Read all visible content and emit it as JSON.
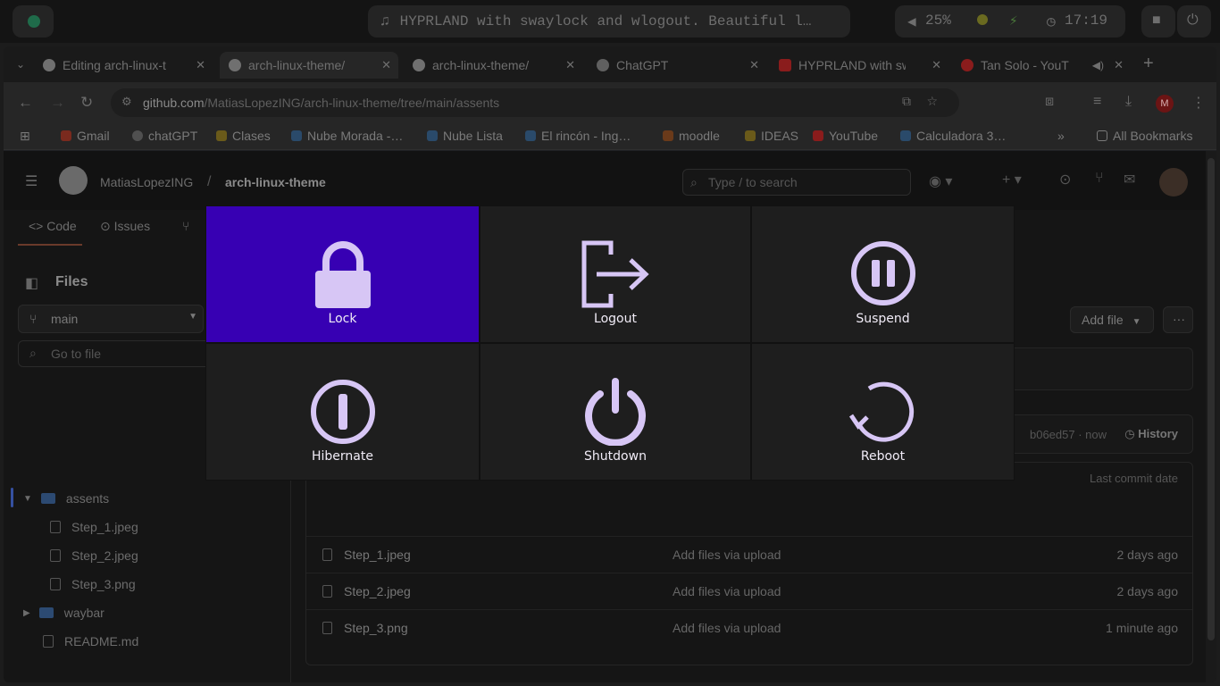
{
  "topbar": {
    "media_title": "HYPRLAND with swaylock and wlogout. Beautiful l…",
    "volume": "25%",
    "clock": "17:19"
  },
  "browser": {
    "tabs": [
      {
        "label": "Editing arch-linux-t",
        "favicon_color": "#707070"
      },
      {
        "label": "arch-linux-theme/",
        "favicon_color": "#707070"
      },
      {
        "label": "arch-linux-theme/",
        "favicon_color": "#707070"
      },
      {
        "label": "ChatGPT",
        "favicon_color": "#606060"
      },
      {
        "label": "HYPRLAND with sw",
        "favicon_color": "#8a1c1c"
      },
      {
        "label": "Tan Solo - YouT",
        "favicon_color": "#8a1c1c"
      }
    ],
    "url_host": "github.com",
    "url_path": "/MatiasLopezING/arch-linux-theme/tree/main/assents",
    "profile_initial": "M",
    "bookmarks": [
      {
        "label": "Gmail",
        "color": "#7a2a1e"
      },
      {
        "label": "chatGPT",
        "color": "#505050"
      },
      {
        "label": "Clases",
        "color": "#6a5a1a"
      },
      {
        "label": "Nube Morada -…",
        "color": "#2a4a6a"
      },
      {
        "label": "Nube Lista",
        "color": "#2a4a6a"
      },
      {
        "label": "El rincón - Ing…",
        "color": "#2a4a6a"
      },
      {
        "label": "moodle",
        "color": "#6a3a1a"
      },
      {
        "label": "IDEAS",
        "color": "#6a5a1a"
      },
      {
        "label": "YouTube",
        "color": "#8a1c1c"
      },
      {
        "label": "Calculadora 3…",
        "color": "#2a4a6a"
      }
    ],
    "all_bookmarks": "All Bookmarks"
  },
  "github": {
    "owner": "MatiasLopezING",
    "repo": "arch-linux-theme",
    "search_placeholder": "Type / to search",
    "repo_tabs": [
      "Code",
      "Issues"
    ],
    "files_title": "Files",
    "branch": "main",
    "goto_file": "Go to file",
    "tree": [
      {
        "name": "assents",
        "type": "dir"
      },
      {
        "name": "Step_1.jpeg",
        "type": "file"
      },
      {
        "name": "Step_2.jpeg",
        "type": "file"
      },
      {
        "name": "Step_3.png",
        "type": "file"
      },
      {
        "name": "waybar",
        "type": "dir"
      },
      {
        "name": "README.md",
        "type": "file"
      }
    ],
    "add_file": "Add file",
    "commit_hash": "b06ed57 · now",
    "history": "History",
    "last_commit_date_header": "Last commit date",
    "rows": [
      {
        "name": "Step_1.jpeg",
        "message": "Add files via upload",
        "date": "2 days ago"
      },
      {
        "name": "Step_2.jpeg",
        "message": "Add files via upload",
        "date": "2 days ago"
      },
      {
        "name": "Step_3.png",
        "message": "Add files via upload",
        "date": "1 minute ago"
      }
    ]
  },
  "wlogout": {
    "selected": "lock",
    "accent_color": "#3700b3",
    "icon_color": "#d7c6f5",
    "buttons": [
      {
        "id": "lock",
        "label": "Lock",
        "icon": "lock-icon"
      },
      {
        "id": "logout",
        "label": "Logout",
        "icon": "logout-icon"
      },
      {
        "id": "suspend",
        "label": "Suspend",
        "icon": "pause-icon"
      },
      {
        "id": "hibernate",
        "label": "Hibernate",
        "icon": "hibernate-icon"
      },
      {
        "id": "shutdown",
        "label": "Shutdown",
        "icon": "power-icon"
      },
      {
        "id": "reboot",
        "label": "Reboot",
        "icon": "reboot-icon"
      }
    ]
  }
}
